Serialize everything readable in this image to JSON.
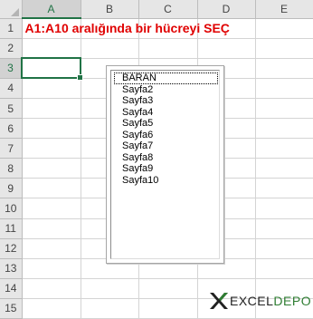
{
  "columns": [
    "A",
    "B",
    "C",
    "D",
    "E"
  ],
  "rows": [
    "1",
    "2",
    "3",
    "4",
    "5",
    "6",
    "7",
    "8",
    "9",
    "10",
    "11",
    "12",
    "13",
    "14",
    "15"
  ],
  "title_text": "A1:A10 aralığında bir hücreyi SEÇ",
  "listbox": {
    "items": [
      "BARAN",
      "Sayfa2",
      "Sayfa3",
      "Sayfa4",
      "Sayfa5",
      "Sayfa6",
      "Sayfa7",
      "Sayfa8",
      "Sayfa9",
      "Sayfa10"
    ]
  },
  "logo": {
    "main": "EXCEL",
    "sub": "DEPO"
  },
  "colors": {
    "accent": "#217346",
    "title": "#e00000",
    "logo_sub": "#2e7d32"
  },
  "active_cell": "A3"
}
